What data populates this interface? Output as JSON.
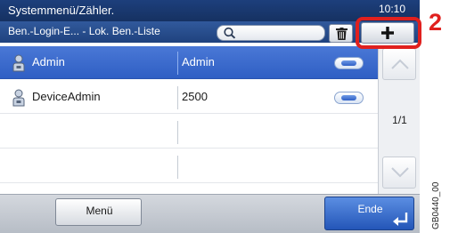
{
  "header": {
    "title": "Systemmenü/Zähler.",
    "clock": "10:10",
    "breadcrumb": "Ben.-Login-E... - Lok. Ben.-Liste"
  },
  "toolbar": {
    "search_icon": "search-icon",
    "delete_icon": "trash-icon",
    "add_label": "+"
  },
  "list": {
    "rows": [
      {
        "name": "Admin",
        "value": "Admin",
        "selected": true
      },
      {
        "name": "DeviceAdmin",
        "value": "2500",
        "selected": false
      },
      {
        "name": "",
        "value": "",
        "selected": false
      },
      {
        "name": "",
        "value": "",
        "selected": false
      }
    ]
  },
  "pagination": {
    "indicator": "1/1"
  },
  "footer": {
    "menu_label": "Menü",
    "end_label": "Ende"
  },
  "annotation": {
    "callout_number": "2",
    "figure_code": "GB0440_00"
  },
  "colors": {
    "header": "#1d3f7c",
    "selected_row": "#3a68cc",
    "callout": "#e0201e"
  }
}
